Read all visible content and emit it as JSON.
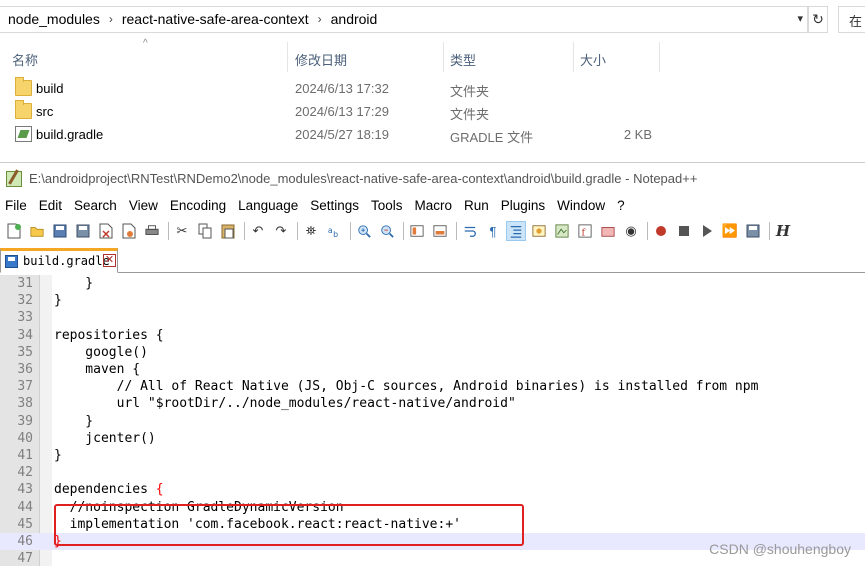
{
  "explorer": {
    "breadcrumbs": [
      "node_modules",
      "react-native-safe-area-context",
      "android"
    ],
    "search_label": "在",
    "columns": [
      "名称",
      "修改日期",
      "类型",
      "大小"
    ],
    "files": [
      {
        "name": "build",
        "date": "2024/6/13 17:32",
        "type": "文件夹",
        "size": "",
        "icon": "folder-icon"
      },
      {
        "name": "src",
        "date": "2024/6/13 17:29",
        "type": "文件夹",
        "size": "",
        "icon": "folder-icon"
      },
      {
        "name": "build.gradle",
        "date": "2024/5/27 18:19",
        "type": "GRADLE 文件",
        "size": "2 KB",
        "icon": "gradle-file-icon"
      }
    ]
  },
  "notepad": {
    "title": "E:\\androidproject\\RNTest\\RNDemo2\\node_modules\\react-native-safe-area-context\\android\\build.gradle - Notepad++",
    "menu": [
      "File",
      "Edit",
      "Search",
      "View",
      "Encoding",
      "Language",
      "Settings",
      "Tools",
      "Macro",
      "Run",
      "Plugins",
      "Window",
      "?"
    ],
    "tab_label": "build.gradle",
    "tab_close": "✕",
    "lines": [
      {
        "n": "31",
        "text": "    }"
      },
      {
        "n": "32",
        "text": "}"
      },
      {
        "n": "33",
        "text": ""
      },
      {
        "n": "34",
        "text": "repositories {"
      },
      {
        "n": "35",
        "text": "    google()"
      },
      {
        "n": "36",
        "text": "    maven {"
      },
      {
        "n": "37",
        "text": "        // All of React Native (JS, Obj-C sources, Android binaries) is installed from npm"
      },
      {
        "n": "38",
        "text": "        url \"$rootDir/../node_modules/react-native/android\""
      },
      {
        "n": "39",
        "text": "    }"
      },
      {
        "n": "40",
        "text": "    jcenter()"
      },
      {
        "n": "41",
        "text": "}"
      },
      {
        "n": "42",
        "text": ""
      },
      {
        "n": "43",
        "text": "dependencies {"
      },
      {
        "n": "44",
        "text": "  //noinspection GradleDynamicVersion"
      },
      {
        "n": "45",
        "text": "  implementation 'com.facebook.react:react-native:+'"
      },
      {
        "n": "46",
        "text": "}"
      },
      {
        "n": "47",
        "text": ""
      }
    ],
    "watermark": "CSDN @shouhengboy"
  }
}
